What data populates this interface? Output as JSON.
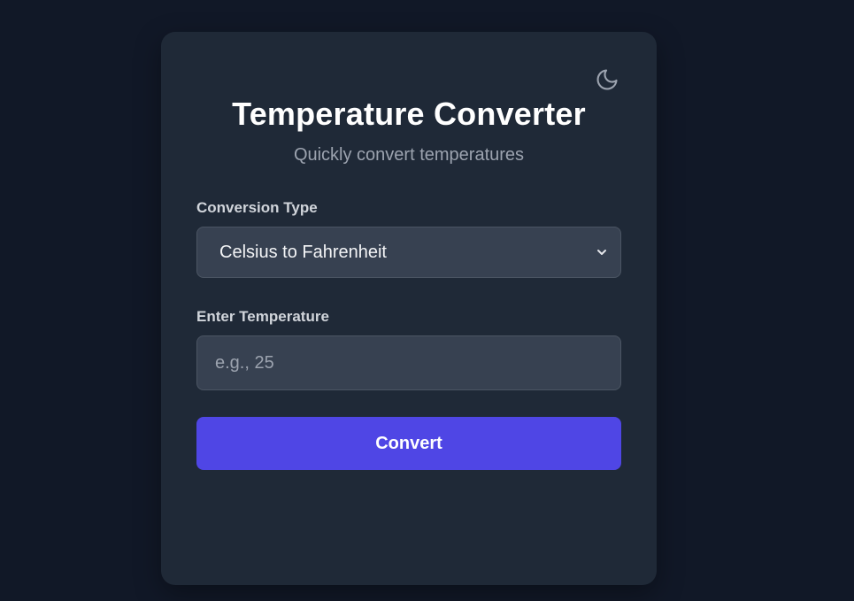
{
  "app": {
    "title": "Temperature Converter",
    "subtitle": "Quickly convert temperatures"
  },
  "theme_toggle": {
    "icon": "moon-icon"
  },
  "form": {
    "conversion_type_label": "Conversion Type",
    "conversion_type_selected": "Celsius to Fahrenheit",
    "temperature_label": "Enter Temperature",
    "temperature_value": "",
    "temperature_placeholder": "e.g., 25",
    "convert_label": "Convert"
  },
  "colors": {
    "page_background": "#111827",
    "card_background": "#1f2937",
    "field_background": "#374151",
    "accent": "#4f46e5",
    "muted_text": "#9ca3af"
  }
}
